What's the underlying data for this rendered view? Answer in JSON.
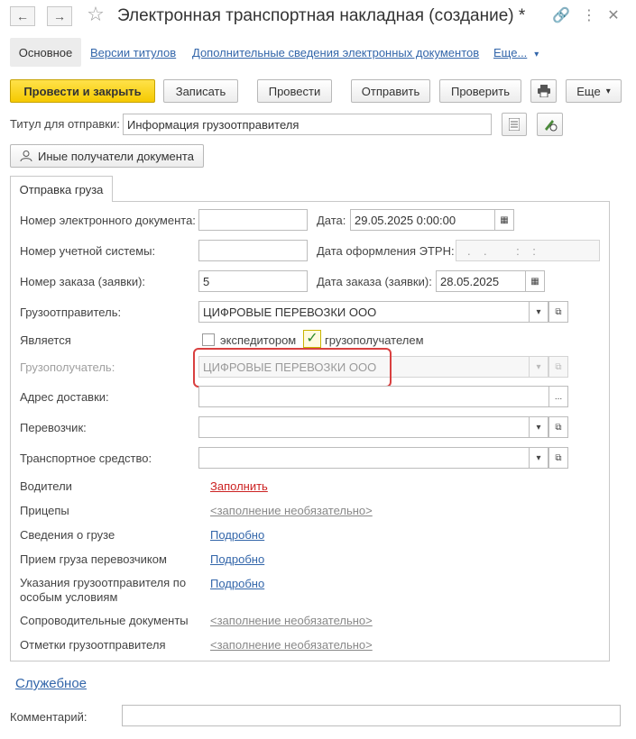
{
  "window": {
    "title": "Электронная транспортная накладная (создание) *",
    "star_glyph": "☆",
    "link_glyph": "🔗",
    "more_glyph": "⋮",
    "close_glyph": "✕",
    "back_glyph": "←",
    "forward_glyph": "→"
  },
  "sections": {
    "main": "Основное",
    "versions": "Версии титулов",
    "extra_info": "Дополнительные сведения электронных документов",
    "more": "Еще..."
  },
  "toolbar": {
    "post_close": "Провести и закрыть",
    "save": "Записать",
    "post": "Провести",
    "send": "Отправить",
    "check": "Проверить",
    "more": "Еще"
  },
  "title_row": {
    "label": "Титул для отправки:",
    "value": "Информация грузоотправителя"
  },
  "other_recipients": "Иные получатели документа",
  "tab": {
    "label": "Отправка груза"
  },
  "form": {
    "doc_number_label": "Номер электронного документа:",
    "doc_number_value": "",
    "date_label": "Дата:",
    "date_value": "29.05.2025  0:00:00",
    "acc_number_label": "Номер учетной системы:",
    "acc_number_value": "",
    "etrn_date_label": "Дата оформления ЭТРН:",
    "etrn_date_value": ".    .         :    :",
    "order_number_label": "Номер заказа (заявки):",
    "order_number_value": "5",
    "order_date_label": "Дата заказа (заявки):",
    "order_date_value": "28.05.2025",
    "shipper_label": "Грузоотправитель:",
    "shipper_value": "ЦИФРОВЫЕ ПЕРЕВОЗКИ ООО",
    "is_label": "Является",
    "forwarder_label": "экспедитором",
    "consignee_cb_label": "грузополучателем",
    "consignee_label": "Грузополучатель:",
    "consignee_value": "ЦИФРОВЫЕ ПЕРЕВОЗКИ ООО",
    "address_label": "Адрес доставки:",
    "address_value": "",
    "carrier_label": "Перевозчик:",
    "carrier_value": "",
    "vehicle_label": "Транспортное средство:",
    "vehicle_value": "",
    "drivers_label": "Водители",
    "drivers_link": "Заполнить",
    "trailers_label": "Прицепы",
    "trailers_link": "<заполнение необязательно>",
    "cargo_label": "Сведения о грузе",
    "cargo_link": "Подробно",
    "acceptance_label": "Прием груза перевозчиком",
    "acceptance_link": "Подробно",
    "instructions_label_1": "Указания грузоотправителя по",
    "instructions_label_2": "особым условиям",
    "instructions_link": "Подробно",
    "docs_label": "Сопроводительные документы",
    "docs_link": "<заполнение необязательно>",
    "marks_label": "Отметки грузоотправителя",
    "marks_link": "<заполнение необязательно>"
  },
  "service_link": "Служебное",
  "comment": {
    "label": "Комментарий:",
    "value": ""
  },
  "icons": {
    "dropdown": "▾",
    "open": "⧉",
    "ellipsis": "...",
    "calendar": "▦",
    "check": "✓"
  }
}
